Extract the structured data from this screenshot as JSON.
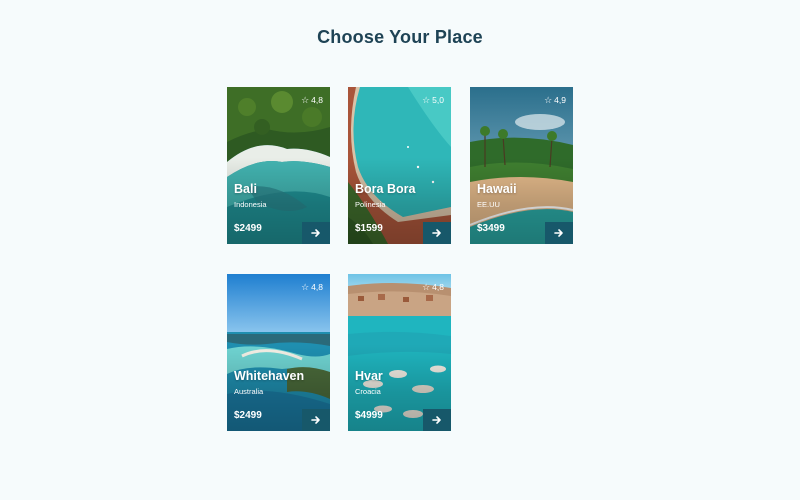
{
  "page": {
    "title": "Choose Your Place"
  },
  "colors": {
    "title": "#1e4355",
    "button": "#17586a",
    "background": "#f6fbfc"
  },
  "icons": {
    "rating": "star-icon",
    "go": "arrow-right-icon"
  },
  "destinations": [
    {
      "name": "Bali",
      "country": "Indonesia",
      "price": "$2499",
      "rating": "4,8"
    },
    {
      "name": "Bora Bora",
      "country": "Polinesia",
      "price": "$1599",
      "rating": "5,0"
    },
    {
      "name": "Hawaii",
      "country": "EE.UU",
      "price": "$3499",
      "rating": "4,9"
    },
    {
      "name": "Whitehaven",
      "country": "Australia",
      "price": "$2499",
      "rating": "4,8"
    },
    {
      "name": "Hvar",
      "country": "Croacia",
      "price": "$4999",
      "rating": "4,8"
    }
  ]
}
